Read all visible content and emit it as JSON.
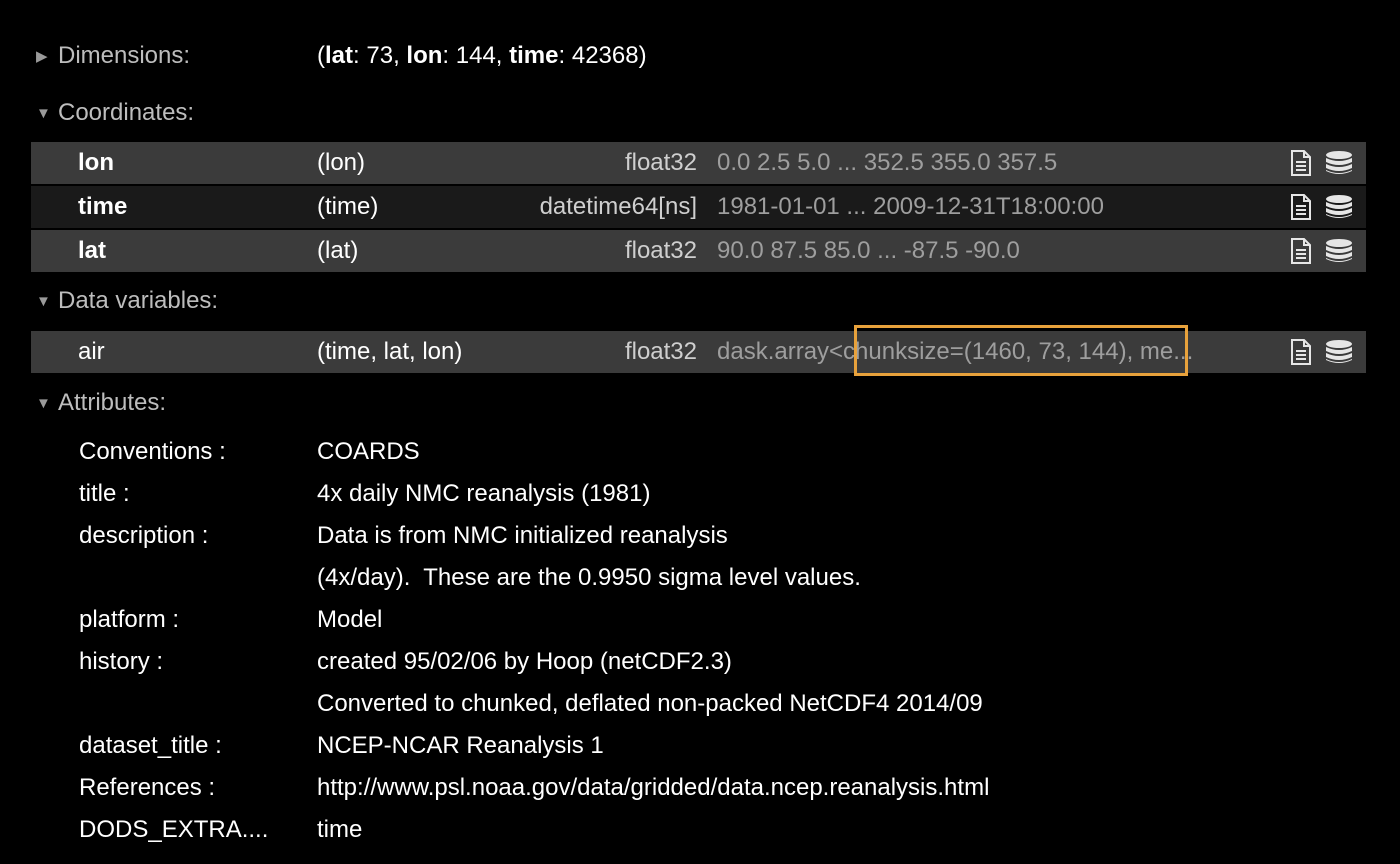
{
  "sections": {
    "dimensions": {
      "label": "Dimensions:",
      "expanded": false
    },
    "coordinates": {
      "label": "Coordinates:",
      "expanded": true
    },
    "data_variables": {
      "label": "Data variables:",
      "expanded": true
    },
    "attributes": {
      "label": "Attributes:",
      "expanded": true
    }
  },
  "dimensions": {
    "open": "(",
    "items": [
      {
        "name": "lat",
        "sep": ": ",
        "value": "73"
      },
      {
        "name": "lon",
        "sep": ": ",
        "value": "144"
      },
      {
        "name": "time",
        "sep": ": ",
        "value": "42368"
      }
    ],
    "comma": ", ",
    "close": ")"
  },
  "coordinates": [
    {
      "name": "lon",
      "dims": "(lon)",
      "dtype": "float32",
      "preview": "0.0 2.5 5.0 ... 352.5 355.0 357.5"
    },
    {
      "name": "time",
      "dims": "(time)",
      "dtype": "datetime64[ns]",
      "preview": "1981-01-01 ... 2009-12-31T18:00:00"
    },
    {
      "name": "lat",
      "dims": "(lat)",
      "dtype": "float32",
      "preview": "90.0 87.5 85.0 ... -87.5 -90.0"
    }
  ],
  "data_variables": [
    {
      "name": "air",
      "dims": "(time, lat, lon)",
      "dtype": "float32",
      "preview": "dask.array<chunksize=(1460, 73, 144), me..."
    }
  ],
  "attributes": [
    {
      "key": "Conventions :",
      "value": "COARDS"
    },
    {
      "key": "title :",
      "value": "4x daily NMC reanalysis (1981)"
    },
    {
      "key": "description :",
      "value": "Data is from NMC initialized reanalysis"
    },
    {
      "key": "",
      "value": "(4x/day).  These are the 0.9950 sigma level values."
    },
    {
      "key": "platform :",
      "value": "Model"
    },
    {
      "key": "history :",
      "value": "created 95/02/06 by Hoop (netCDF2.3)"
    },
    {
      "key": "",
      "value": "Converted to chunked, deflated non-packed NetCDF4 2014/09"
    },
    {
      "key": "dataset_title :",
      "value": "NCEP-NCAR Reanalysis 1"
    },
    {
      "key": "References :",
      "value": "http://www.psl.noaa.gov/data/gridded/data.ncep.reanalysis.html"
    },
    {
      "key": "DODS_EXTRA....",
      "value": "time"
    }
  ],
  "icons": {
    "attrs": "file-text-icon",
    "data": "database-icon"
  },
  "colors": {
    "background": "#000000",
    "row_light": "#3b3b3b",
    "row_dark": "#1a1a1a",
    "highlight": "#e8a23c",
    "muted_text": "#9e9e9e"
  }
}
